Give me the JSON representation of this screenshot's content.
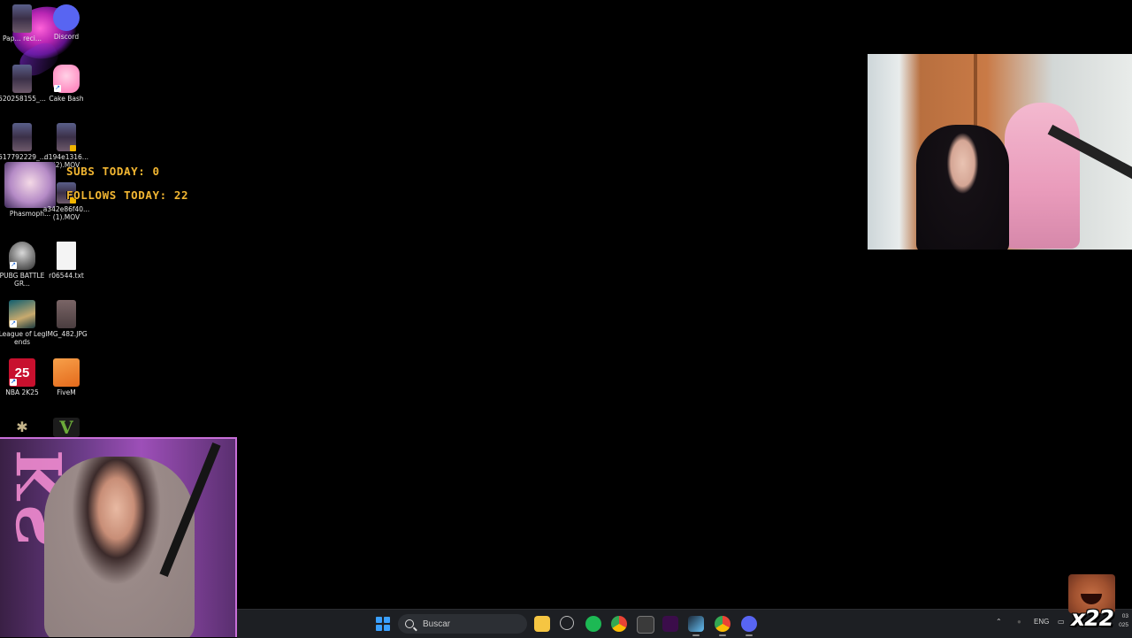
{
  "desktop": {
    "icons": [
      {
        "label": "Pap... reci...",
        "icon": "portrait-video-icon"
      },
      {
        "label": "Discord",
        "icon": "discord-icon"
      },
      {
        "label": "520258155_...",
        "icon": "portrait-video-icon"
      },
      {
        "label": "Cake Bash",
        "icon": "cake-bash-icon"
      },
      {
        "label": "517792229_...",
        "icon": "portrait-video-icon"
      },
      {
        "label": "d194e1316... (2).MOV",
        "icon": "video-file-icon"
      },
      {
        "label": "Phasmoph...",
        "icon": "phasmophobia-icon"
      },
      {
        "label": "a342e86f40... (1).MOV",
        "icon": "video-file-icon"
      },
      {
        "label": "PUBG BATTLEGR...",
        "icon": "pubg-icon"
      },
      {
        "label": "r06544.txt",
        "icon": "text-file-icon"
      },
      {
        "label": "League of Legends",
        "icon": "league-of-legends-icon"
      },
      {
        "label": "IMG_482.JPG",
        "icon": "image-file-icon"
      },
      {
        "label": "NBA 2K25",
        "icon": "nba-2k25-icon",
        "glyph": "25"
      },
      {
        "label": "FiveM",
        "icon": "fivem-icon"
      },
      {
        "label": "",
        "icon": "app-icon"
      },
      {
        "label": "",
        "icon": "gta-v-icon",
        "glyph": "V"
      }
    ]
  },
  "overlay": {
    "subs_today": "SUBS TODAY: 0",
    "follows_today": "FOLLOWS TODAY: 22"
  },
  "taskbar": {
    "search_placeholder": "Buscar",
    "language": "ENG",
    "clock_line1": "03",
    "clock_line2": "025",
    "apps": [
      "file-explorer-icon",
      "cheat-engine-icon",
      "spotify-icon",
      "chrome-icon",
      "terminal-icon",
      "kick-icon",
      "steam-icon",
      "chrome-alt-icon",
      "discord-icon"
    ]
  },
  "alerts": {
    "emote_counter": "x22"
  },
  "colors": {
    "overlay_text": "#f2b632",
    "taskbar_bg": "#1d1f23",
    "cam_border": "#c86fd8"
  }
}
